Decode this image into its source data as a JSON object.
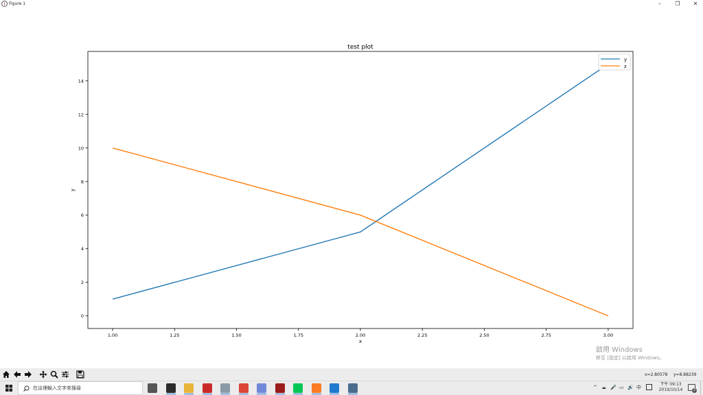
{
  "window": {
    "title": "Figure 1",
    "controls": {
      "minimize": "–",
      "restore": "❐",
      "close": "✕"
    }
  },
  "chart_data": {
    "type": "line",
    "title": "test plot",
    "xlabel": "x",
    "ylabel": "y",
    "xlim": [
      0.9,
      3.1
    ],
    "ylim": [
      -0.75,
      15.75
    ],
    "xticks": [
      1.0,
      1.25,
      1.5,
      1.75,
      2.0,
      2.25,
      2.5,
      2.75,
      3.0
    ],
    "xtick_labels": [
      "1.00",
      "1.25",
      "1.50",
      "1.75",
      "2.00",
      "2.25",
      "2.50",
      "2.75",
      "3.00"
    ],
    "yticks": [
      0,
      2,
      4,
      6,
      8,
      10,
      12,
      14
    ],
    "ytick_labels": [
      "0",
      "2",
      "4",
      "6",
      "8",
      "10",
      "12",
      "14"
    ],
    "grid": false,
    "legend_position": "upper right",
    "series": [
      {
        "name": "y",
        "color": "#1f77b4",
        "x": [
          1,
          2,
          3
        ],
        "y": [
          1,
          5,
          15
        ]
      },
      {
        "name": "z",
        "color": "#ff7f0e",
        "x": [
          1,
          2,
          3
        ],
        "y": [
          10,
          6,
          0
        ]
      }
    ]
  },
  "toolbar": {
    "buttons": [
      "home-icon",
      "back-icon",
      "forward-icon",
      "pan-icon",
      "zoom-icon",
      "configure-subplots-icon",
      "save-icon"
    ],
    "coords_x": "x=2.80578",
    "coords_y": "y=8.88239"
  },
  "watermark": {
    "line1": "啟用 Windows",
    "line2": "移至 [設定] 以啟用 Windows。"
  },
  "taskbar": {
    "search_placeholder": "在這裡輸入文字來搜尋",
    "apps": [
      {
        "name": "task-view-icon",
        "color": "#555555"
      },
      {
        "name": "obs-icon",
        "color": "#2b2b2b"
      },
      {
        "name": "file-explorer-icon",
        "color": "#e8b43a"
      },
      {
        "name": "red-app-icon",
        "color": "#cc2a2a"
      },
      {
        "name": "photos-icon",
        "color": "#8a9aa8"
      },
      {
        "name": "chrome-icon",
        "color": "#db4437"
      },
      {
        "name": "discord-icon",
        "color": "#7289da"
      },
      {
        "name": "dark-red-app-icon",
        "color": "#9b1c1c"
      },
      {
        "name": "line-icon",
        "color": "#06c755"
      },
      {
        "name": "xampp-icon",
        "color": "#fb7a24"
      },
      {
        "name": "vscode-icon",
        "color": "#1f7ad0"
      },
      {
        "name": "python-figure-icon",
        "color": "#4a6d8c"
      }
    ],
    "tray_symbols": [
      "^",
      "☁",
      "🎤",
      "▭",
      "🔊",
      "中"
    ],
    "clock_time": "下午 09:13",
    "clock_date": "2019/10/14",
    "notification_count": "2"
  }
}
